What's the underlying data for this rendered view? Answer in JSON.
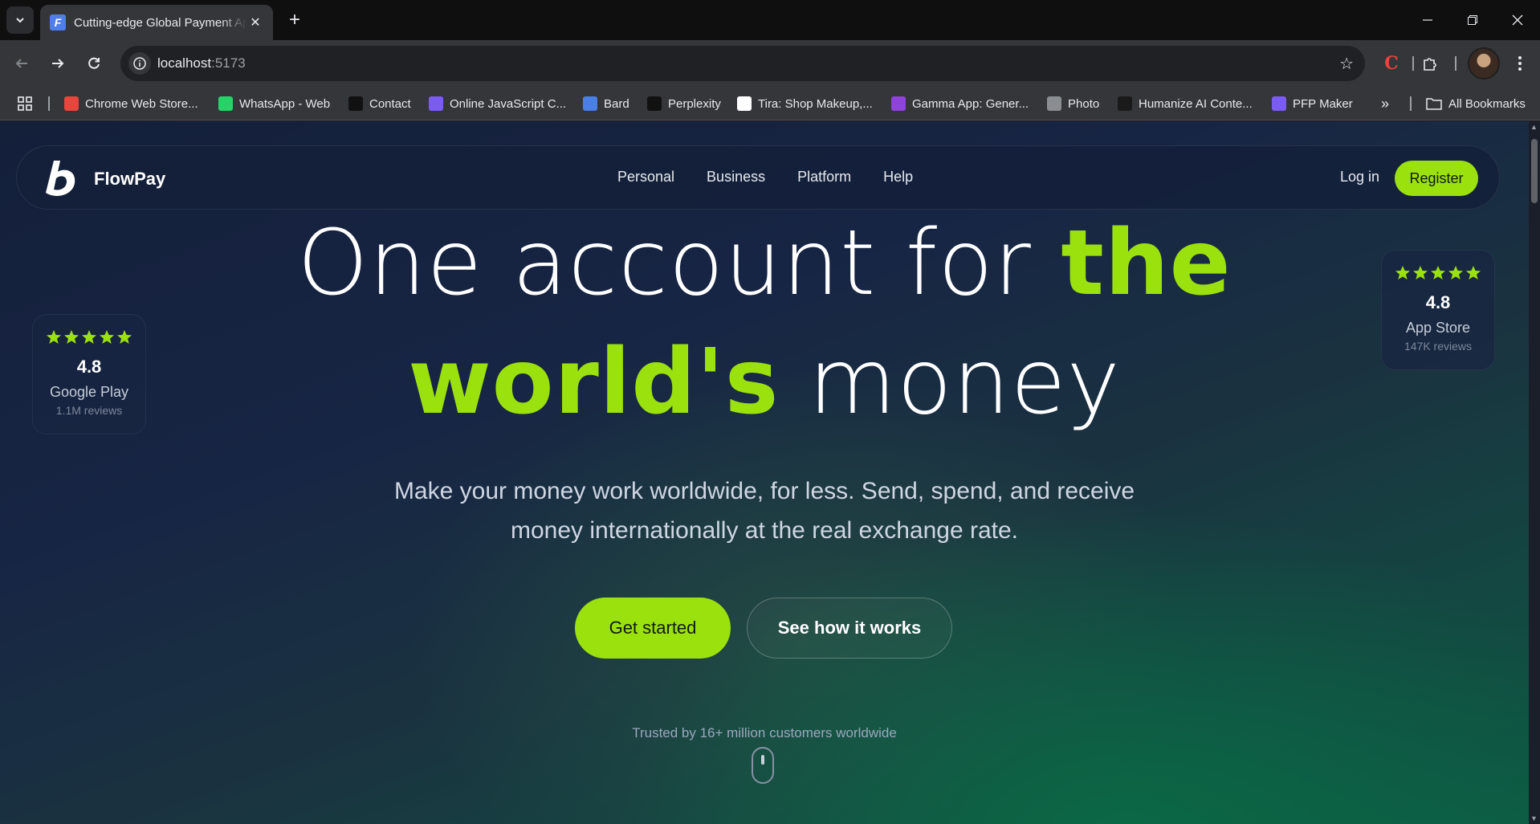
{
  "browser": {
    "tab_title": "Cutting-edge Global Payment App",
    "url_host": "localhost",
    "url_port": ":5173",
    "bookmarks": [
      {
        "label": "Chrome Web Store...",
        "icon": "chrome-web-store-icon",
        "color": "#e8453c"
      },
      {
        "label": "WhatsApp - Web",
        "icon": "whatsapp-icon",
        "color": "#25d366"
      },
      {
        "label": "Contact",
        "icon": "contact-icon",
        "color": "#111111"
      },
      {
        "label": "Online JavaScript C...",
        "icon": "js-compiler-icon",
        "color": "#7b5cf0"
      },
      {
        "label": "Bard",
        "icon": "bard-icon",
        "color": "#4a7fe8"
      },
      {
        "label": "Perplexity",
        "icon": "perplexity-icon",
        "color": "#111111"
      },
      {
        "label": "Tira: Shop Makeup,...",
        "icon": "tira-icon",
        "color": "#ffffff"
      },
      {
        "label": "Gamma App: Gener...",
        "icon": "gamma-icon",
        "color": "#8e44d8"
      },
      {
        "label": "Photo",
        "icon": "globe-icon",
        "color": "#8a8d92"
      },
      {
        "label": "Humanize AI Conte...",
        "icon": "humanize-icon",
        "color": "#1a1a1a"
      },
      {
        "label": "PFP Maker",
        "icon": "pfp-maker-icon",
        "color": "#7b5cf0"
      }
    ],
    "all_bookmarks": "All Bookmarks"
  },
  "nav": {
    "brand": "FlowPay",
    "links": [
      "Personal",
      "Business",
      "Platform",
      "Help"
    ],
    "login": "Log in",
    "register": "Register"
  },
  "hero": {
    "line1_plain": "One account for ",
    "line1_highlight": "the",
    "line2_highlight": "world's",
    "line2_plain": " money",
    "subtitle": "Make your money work worldwide, for less. Send, spend, and receive money internationally at the real exchange rate.",
    "cta_primary": "Get started",
    "cta_secondary": "See how it works",
    "trusted": "Trusted by 16+ million customers worldwide"
  },
  "ratings": {
    "google_play": {
      "score": "4.8",
      "store": "Google Play",
      "reviews": "1.1M reviews",
      "stars": 5
    },
    "app_store": {
      "score": "4.8",
      "store": "App Store",
      "reviews": "147K reviews",
      "stars": 5
    }
  },
  "colors": {
    "accent": "#9be10e",
    "background": "#14203a"
  }
}
